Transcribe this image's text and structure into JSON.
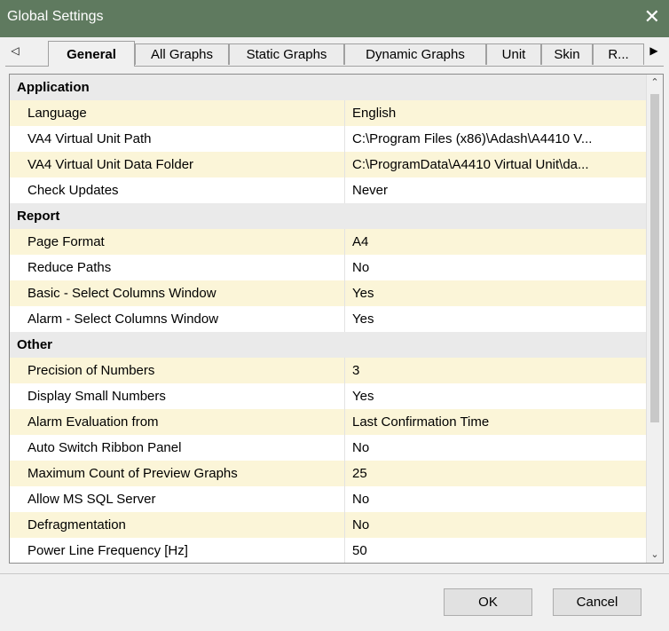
{
  "window": {
    "title": "Global Settings",
    "close_glyph": "✕"
  },
  "tabs": {
    "scroll_left": "◁",
    "scroll_right": "▶",
    "items": [
      {
        "label": "General",
        "active": true
      },
      {
        "label": "All Graphs"
      },
      {
        "label": "Static Graphs"
      },
      {
        "label": "Dynamic Graphs"
      },
      {
        "label": "Unit"
      },
      {
        "label": "Skin"
      },
      {
        "label": "R..."
      }
    ]
  },
  "categories": [
    {
      "title": "Application",
      "rows": [
        {
          "name": "Language",
          "value": "English"
        },
        {
          "name": "VA4 Virtual Unit Path",
          "value": "C:\\Program Files (x86)\\Adash\\A4410 V..."
        },
        {
          "name": "VA4 Virtual Unit Data Folder",
          "value": "C:\\ProgramData\\A4410 Virtual Unit\\da..."
        },
        {
          "name": "Check Updates",
          "value": "Never"
        }
      ]
    },
    {
      "title": "Report",
      "rows": [
        {
          "name": "Page Format",
          "value": "A4"
        },
        {
          "name": "Reduce Paths",
          "value": "No"
        },
        {
          "name": "Basic - Select Columns Window",
          "value": "Yes"
        },
        {
          "name": "Alarm - Select Columns Window",
          "value": "Yes"
        }
      ]
    },
    {
      "title": "Other",
      "rows": [
        {
          "name": "Precision of Numbers",
          "value": "3"
        },
        {
          "name": "Display Small Numbers",
          "value": "Yes"
        },
        {
          "name": "Alarm Evaluation from",
          "value": "Last Confirmation Time"
        },
        {
          "name": "Auto Switch Ribbon Panel",
          "value": "No"
        },
        {
          "name": "Maximum Count of Preview Graphs",
          "value": "25"
        },
        {
          "name": "Allow MS SQL Server",
          "value": "No"
        },
        {
          "name": "Defragmentation",
          "value": "No"
        },
        {
          "name": "Power Line Frequency [Hz]",
          "value": "50"
        }
      ]
    }
  ],
  "scrollbar": {
    "up_glyph": "⌃",
    "down_glyph": "⌄"
  },
  "buttons": {
    "ok": "OK",
    "cancel": "Cancel"
  }
}
